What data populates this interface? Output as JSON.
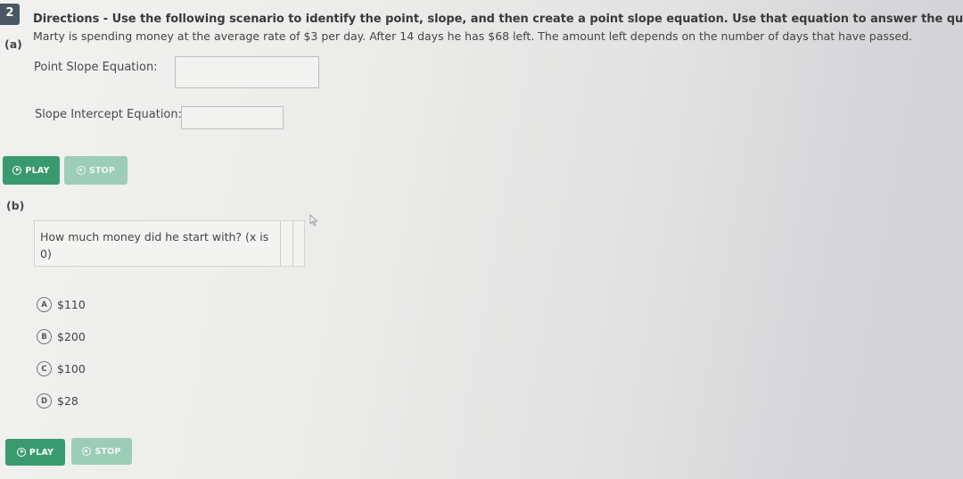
{
  "question": {
    "number": "2",
    "directions": "Directions - Use the following scenario to identify the point, slope, and then create a point slope equation. Use that equation to answer the questions that follow.",
    "scenario": "Marty is spending money at the average rate of $3 per day. After 14 days he has $68 left. The amount left depends on the number of days that have passed."
  },
  "part_a": {
    "label": "(a)",
    "point_slope_label": "Point Slope Equation:",
    "point_slope_value": "",
    "slope_intercept_label": "Slope Intercept Equation:",
    "slope_intercept_value": "",
    "play_label": "PLAY",
    "stop_label": "STOP"
  },
  "part_b": {
    "label": "(b)",
    "question": "How much money did he start with? (x is 0)",
    "choices": [
      {
        "letter": "A",
        "value": "$110"
      },
      {
        "letter": "B",
        "value": "$200"
      },
      {
        "letter": "C",
        "value": "$100"
      },
      {
        "letter": "D",
        "value": "$28"
      }
    ],
    "play_label": "PLAY",
    "stop_label": "STOP"
  },
  "icons": {
    "play": "play-circle-icon",
    "stop": "stop-circle-icon",
    "cursor": "mouse-pointer-icon"
  },
  "colors": {
    "play_button": "#3a9a6f",
    "stop_button": "#9ccdb7",
    "question_badge": "#4a5663"
  }
}
